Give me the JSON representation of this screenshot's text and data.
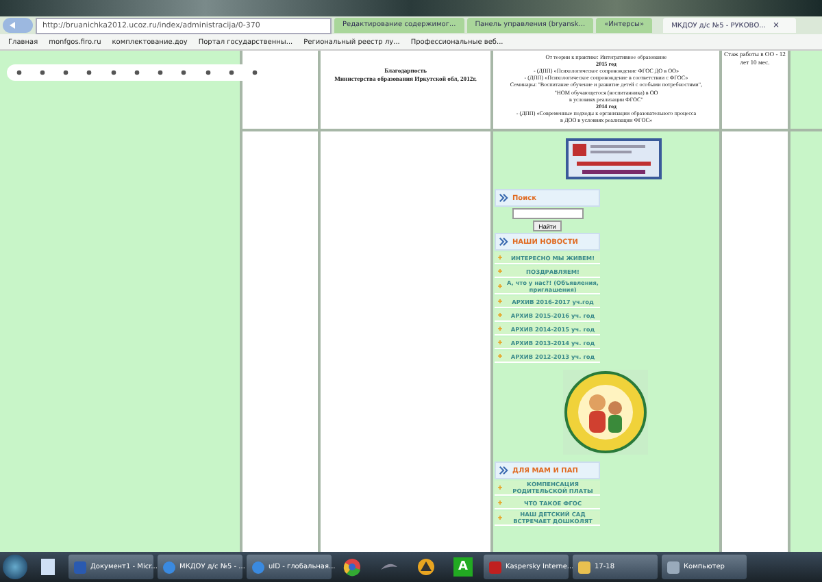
{
  "browser": {
    "address": "http://bruanichka2012.ucoz.ru/index/administracija/0-370",
    "tabs": [
      {
        "label": "Редактирование содержимог...",
        "selected": false
      },
      {
        "label": "Панель управления (bryansk...",
        "selected": false
      },
      {
        "label": "«Интерсы»",
        "selected": false
      },
      {
        "label": "МКДОУ д/с №5 - РУКОВО...",
        "selected": true,
        "close": "×"
      }
    ],
    "bookmarks": [
      "Главная",
      "monfgos.firo.ru",
      "комплектование.доу",
      "Портал государственны...",
      "Региональный реестр лу...",
      "Профессиональные веб..."
    ]
  },
  "table_row": {
    "award_title": "Благодарность",
    "award_text": "Министерства образования Иркутской обл, 2012г.",
    "courses": [
      {
        "text": "От теории к практике: Интегративное образование",
        "bold": false
      },
      {
        "text": "2015 год",
        "bold": true
      },
      {
        "text": "- (ДПП) «Психологическое сопровождение ФГОС ДО в ОО»",
        "bold": false
      },
      {
        "text": "- (ДПП) «Психологическое сопровождение в соответствии с ФГОС»",
        "bold": false
      },
      {
        "text": "Семинары: \"Воспитание обучение и развитие детей с особыми потребностями\",",
        "bold": false
      },
      {
        "text": "\"НОМ обучающегося (воспитанника) в ОО",
        "bold": false
      },
      {
        "text": "в условиях реализации ФГОС\"",
        "bold": false
      },
      {
        "text": "2014 год",
        "bold": true
      },
      {
        "text": "- (ДПП) «Современные подходы к организации образовательного процесса",
        "bold": false
      },
      {
        "text": "в ДОО в условиях реализации ФГОС»",
        "bold": false
      }
    ],
    "experience": "Стаж работы в ОО - 12 лет 10 мес."
  },
  "search": {
    "title": "Поиск",
    "button": "Найти"
  },
  "news": {
    "title": "НАШИ НОВОСТИ",
    "items": [
      "ИНТЕРЕСНО МЫ ЖИВЕМ!",
      "ПОЗДРАВЛЯЕМ!",
      "А, что у нас?! (Объявления, приглашения)",
      "АРХИВ 2016-2017 уч.год",
      "АРХИВ 2015-2016 уч. год",
      "АРХИВ 2014-2015 уч. год",
      "АРХИВ 2013-2014 уч. год",
      "АРХИВ 2012-2013 уч. год"
    ]
  },
  "parents": {
    "title": "ДЛЯ МАМ И ПАП",
    "items": [
      "КОМПЕНСАЦИЯ РОДИТЕЛЬСКОЙ ПЛАТЫ",
      "ЧТО ТАКОЕ ФГОС",
      "НАШ ДЕТСКИЙ САД ВСТРЕЧАЕТ ДОШКОЛЯТ"
    ]
  },
  "taskbar": [
    {
      "kind": "word",
      "label": "Документ1 - Micr..."
    },
    {
      "kind": "ie",
      "label": "МКДОУ д/с №5 - ..."
    },
    {
      "kind": "ie",
      "label": "uID - глобальная..."
    },
    {
      "kind": "chrome"
    },
    {
      "kind": "app"
    },
    {
      "kind": "app2"
    },
    {
      "kind": "letter",
      "label": "A"
    },
    {
      "kind": "kaspersky",
      "label": "Kaspersky Interne..."
    },
    {
      "kind": "folder",
      "label": "17-18"
    },
    {
      "kind": "computer",
      "label": "Компьютер"
    }
  ]
}
